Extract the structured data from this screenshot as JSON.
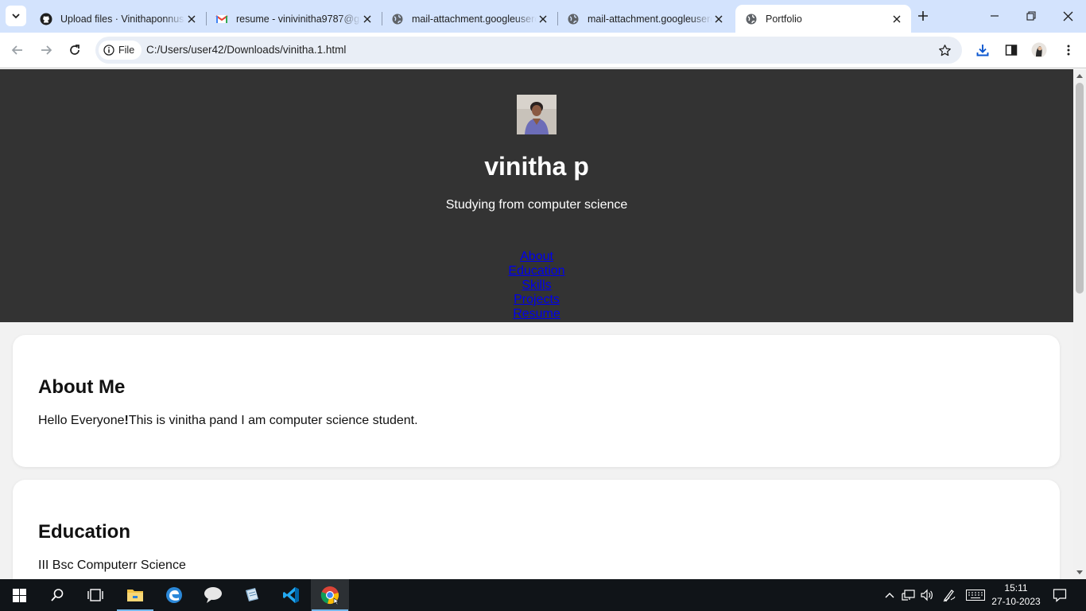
{
  "browser": {
    "tabs": [
      {
        "title": "Upload files · Vinithaponnusamy",
        "icon": "github-icon",
        "active": false
      },
      {
        "title": "resume - vinivinitha9787@gmail.com",
        "icon": "gmail-icon",
        "active": false
      },
      {
        "title": "mail-attachment.googleusercontent.com",
        "icon": "globe-icon",
        "active": false
      },
      {
        "title": "mail-attachment.googleusercontent.com",
        "icon": "globe-icon",
        "active": false
      },
      {
        "title": "Portfolio",
        "icon": "globe-icon",
        "active": true
      }
    ],
    "site_info_label": "File",
    "address": "C:/Users/user42/Downloads/vinitha.1.html"
  },
  "page": {
    "header": {
      "name": "vinitha p",
      "tagline": "Studying from computer science",
      "nav": [
        "About",
        "Education",
        "Skills",
        "Projects",
        "Resume"
      ]
    },
    "about": {
      "heading": "About Me",
      "text_before": "Hello Everyone",
      "text_bold": "!",
      "text_after": "This is vinitha pand I am computer science student."
    },
    "education": {
      "heading": "Education",
      "text": "III Bsc Computerr Science"
    }
  },
  "taskbar": {
    "apps": [
      "start-icon",
      "search-icon",
      "task-view-icon",
      "file-explorer-icon",
      "edge-icon",
      "chat-icon",
      "notepad-icon",
      "vscode-icon",
      "chrome-icon"
    ],
    "time": "15:11",
    "date": "27-10-2023"
  },
  "colors": {
    "tabstrip": "#d3e3fd",
    "header_bg": "#333333",
    "link": "#0000ee",
    "page_bg": "#f2f2f2",
    "taskbar": "#101418"
  }
}
